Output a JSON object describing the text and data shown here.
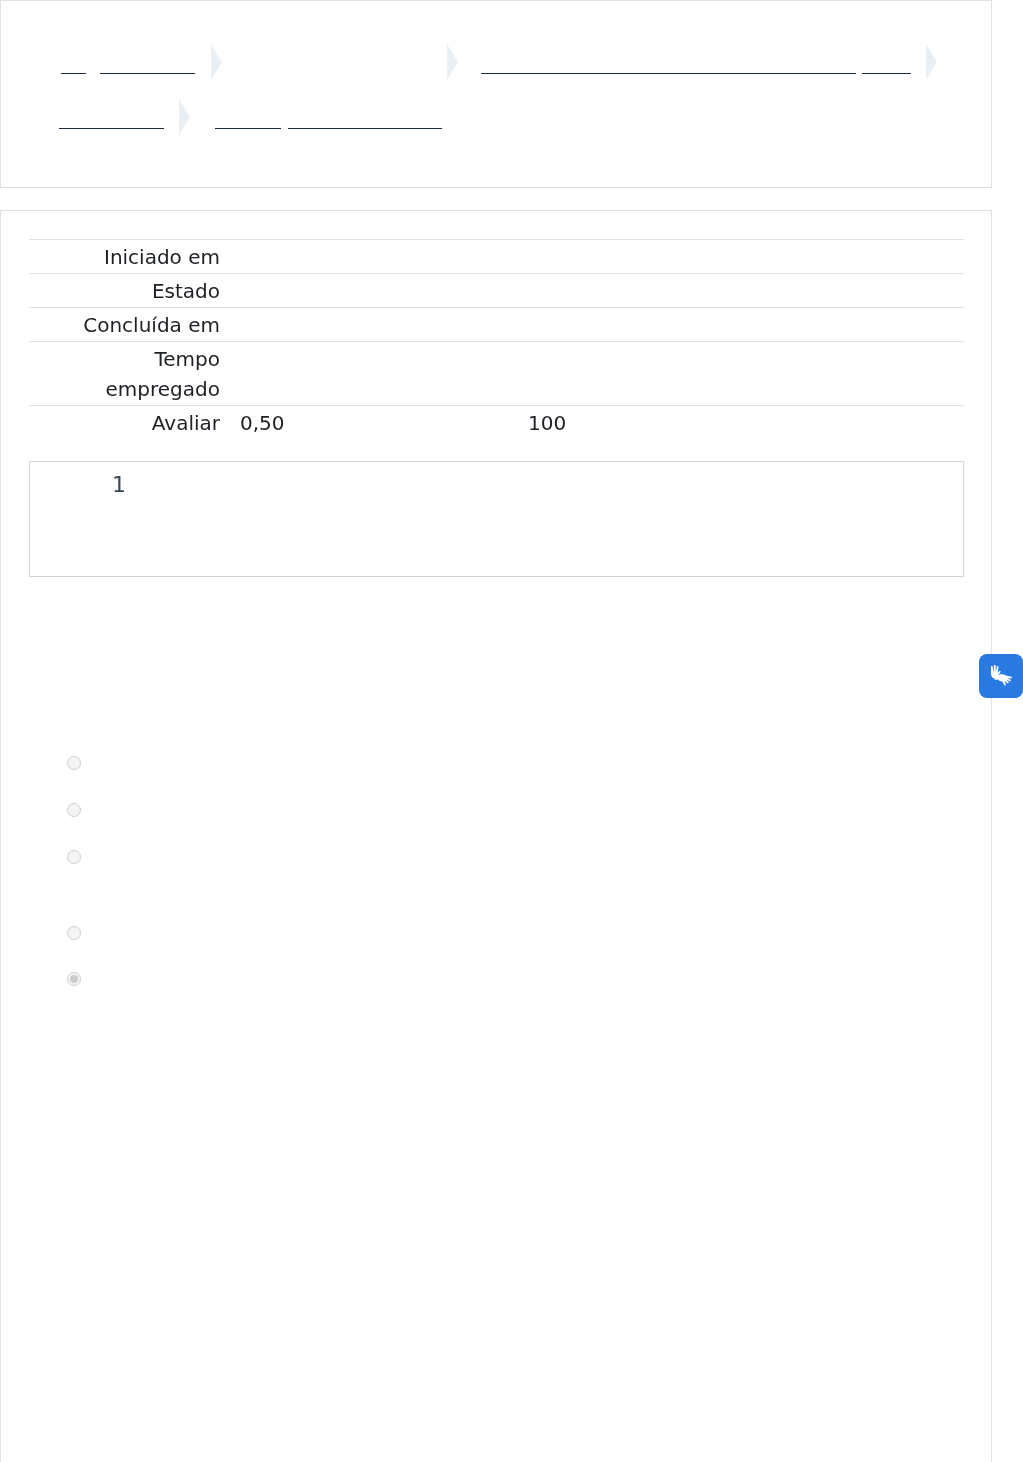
{
  "summary": [
    {
      "label": "Iniciado em"
    },
    {
      "label": "Estado"
    },
    {
      "label": "Concluída em"
    },
    {
      "label": "Tempo empregado"
    },
    {
      "label": "Avaliar",
      "values": [
        "0,50",
        "100"
      ]
    }
  ],
  "question": {
    "number": "1"
  },
  "answers": [
    {
      "selected": false
    },
    {
      "selected": false
    },
    {
      "selected": false
    },
    {
      "selected": false
    },
    {
      "selected": true
    }
  ]
}
